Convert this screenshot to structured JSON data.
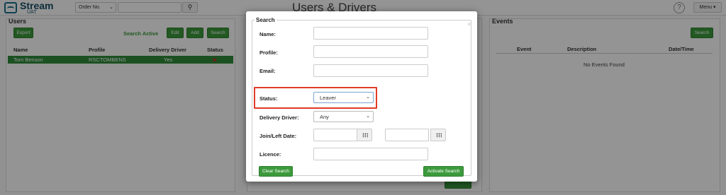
{
  "app": {
    "logo_text": "Stream",
    "logo_sub": "UAT",
    "title": "Users & Drivers",
    "order_select": "Order No.",
    "help": "?",
    "menu": "Menu"
  },
  "users_panel": {
    "title": "Users",
    "export_btn": "Export",
    "search_active": "Search Active",
    "edit_btn": "Edit",
    "add_btn": "Add",
    "search_btn": "Search",
    "columns": [
      "Name",
      "Profile",
      "Delivery Driver",
      "Status"
    ],
    "rows": [
      {
        "name": "Tom Benson",
        "profile": "RSCTOMBENS",
        "driver": "Yes",
        "status_icon": "x-icon"
      }
    ]
  },
  "events_panel": {
    "title": "Events",
    "search_btn": "Search",
    "columns": [
      "Event",
      "Description",
      "Date/Time"
    ],
    "empty": "No Events Found"
  },
  "search_modal": {
    "legend": "Search",
    "close": "×",
    "labels": {
      "name": "Name:",
      "profile": "Profile:",
      "email": "Email:",
      "status": "Status:",
      "driver": "Delivery Driver:",
      "date": "Join/Left Date:",
      "licence": "Licence:"
    },
    "status_value": "Leaver",
    "driver_value": "Any",
    "clear_btn": "Clear Search",
    "activate_btn": "Activate Search"
  },
  "colors": {
    "accent_green": "#3c9a3c",
    "highlight_red": "#e23b28"
  }
}
